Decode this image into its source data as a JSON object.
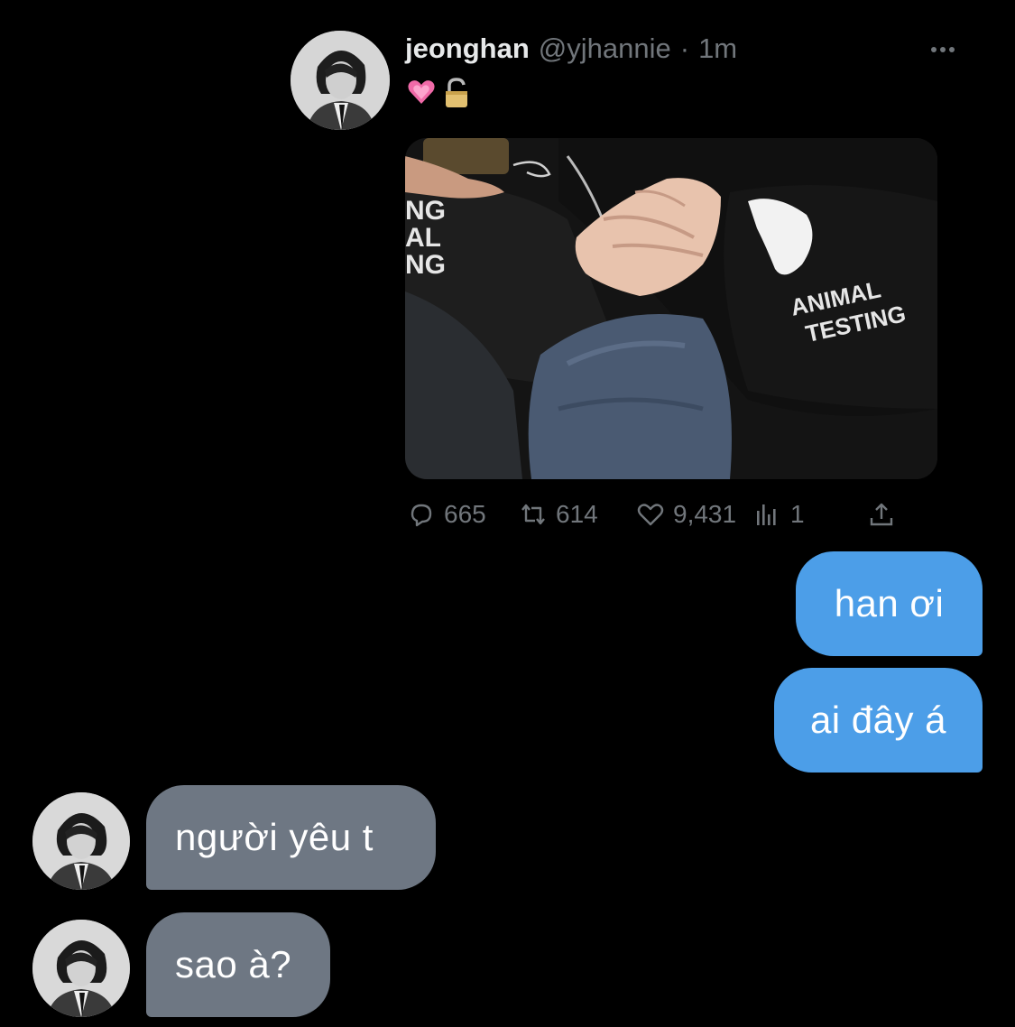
{
  "tweet": {
    "author_name": "jeonghan",
    "author_handle": "@yjhannie",
    "separator": "·",
    "time": "1m",
    "emojis": [
      "heart-emoji",
      "lock-emoji"
    ],
    "media_text_left": [
      "NG",
      "AL",
      "NG"
    ],
    "media_text_right": [
      "ANIMAL",
      "TESTING"
    ],
    "actions": {
      "replies": "665",
      "retweets": "614",
      "likes": "9,431",
      "views": "1"
    }
  },
  "chat": {
    "messages": [
      {
        "sender": "me",
        "text": "han ơi"
      },
      {
        "sender": "me",
        "text": "ai đây á"
      },
      {
        "sender": "them",
        "text": "người yêu t"
      },
      {
        "sender": "them",
        "text": "sao à?"
      }
    ]
  },
  "colors": {
    "background": "#000000",
    "sent_bubble": "#4c9ee8",
    "received_bubble": "#6e7783",
    "muted_text": "#71767b",
    "primary_text": "#e7e9ea"
  }
}
